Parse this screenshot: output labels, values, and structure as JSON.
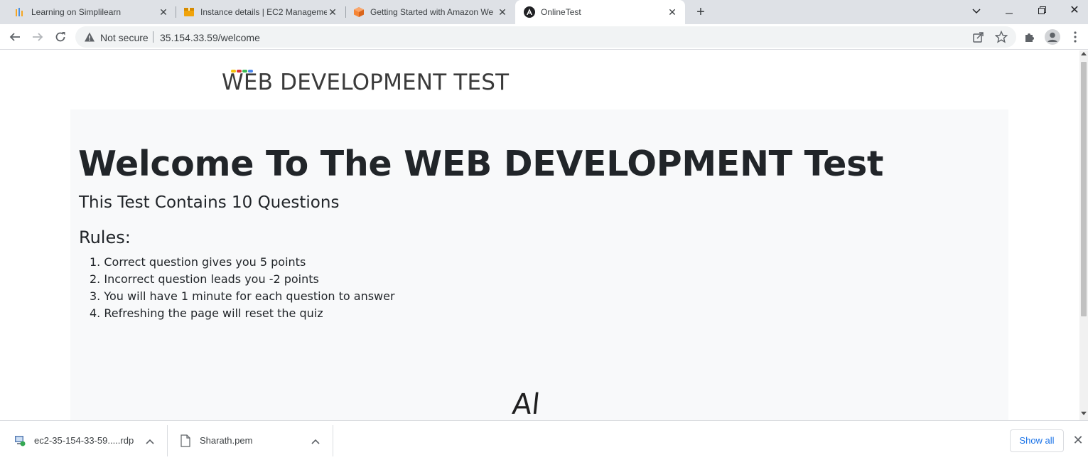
{
  "browser": {
    "tabs": [
      {
        "title": "Learning on Simplilearn",
        "icon": "simplilearn-icon"
      },
      {
        "title": "Instance details | EC2 Manageme",
        "icon": "aws-box-icon"
      },
      {
        "title": "Getting Started with Amazon We",
        "icon": "aws-cube-icon"
      },
      {
        "title": "OnlineTest",
        "icon": "angular-icon",
        "active": true
      }
    ],
    "omnibox": {
      "security_label": "Not secure",
      "url": "35.154.33.59/welcome"
    }
  },
  "page": {
    "site_title": "WEB DEVELOPMENT TEST",
    "welcome_heading": "Welcome To The WEB DEVELOPMENT Test",
    "subtitle": "This Test Contains 10 Questions",
    "rules_heading": "Rules:",
    "rules": [
      "1. Correct question gives you 5 points",
      "2. Incorrect question leads you -2 points",
      "3. You will have 1 minute for each question to answer",
      "4. Refreshing the page will reset the quiz"
    ],
    "glyph_al": "Al",
    "glyph_lt": "<"
  },
  "downloads": {
    "items": [
      {
        "name": "ec2-35-154-33-59.....rdp",
        "icon": "rdp-file-icon"
      },
      {
        "name": "Sharath.pem",
        "icon": "file-icon"
      }
    ],
    "show_all_label": "Show all"
  },
  "colors": {
    "tab_strip": "#dee1e6",
    "panel_bg": "#f8f9fa",
    "text": "#212529",
    "link_blue": "#1a73e8"
  }
}
